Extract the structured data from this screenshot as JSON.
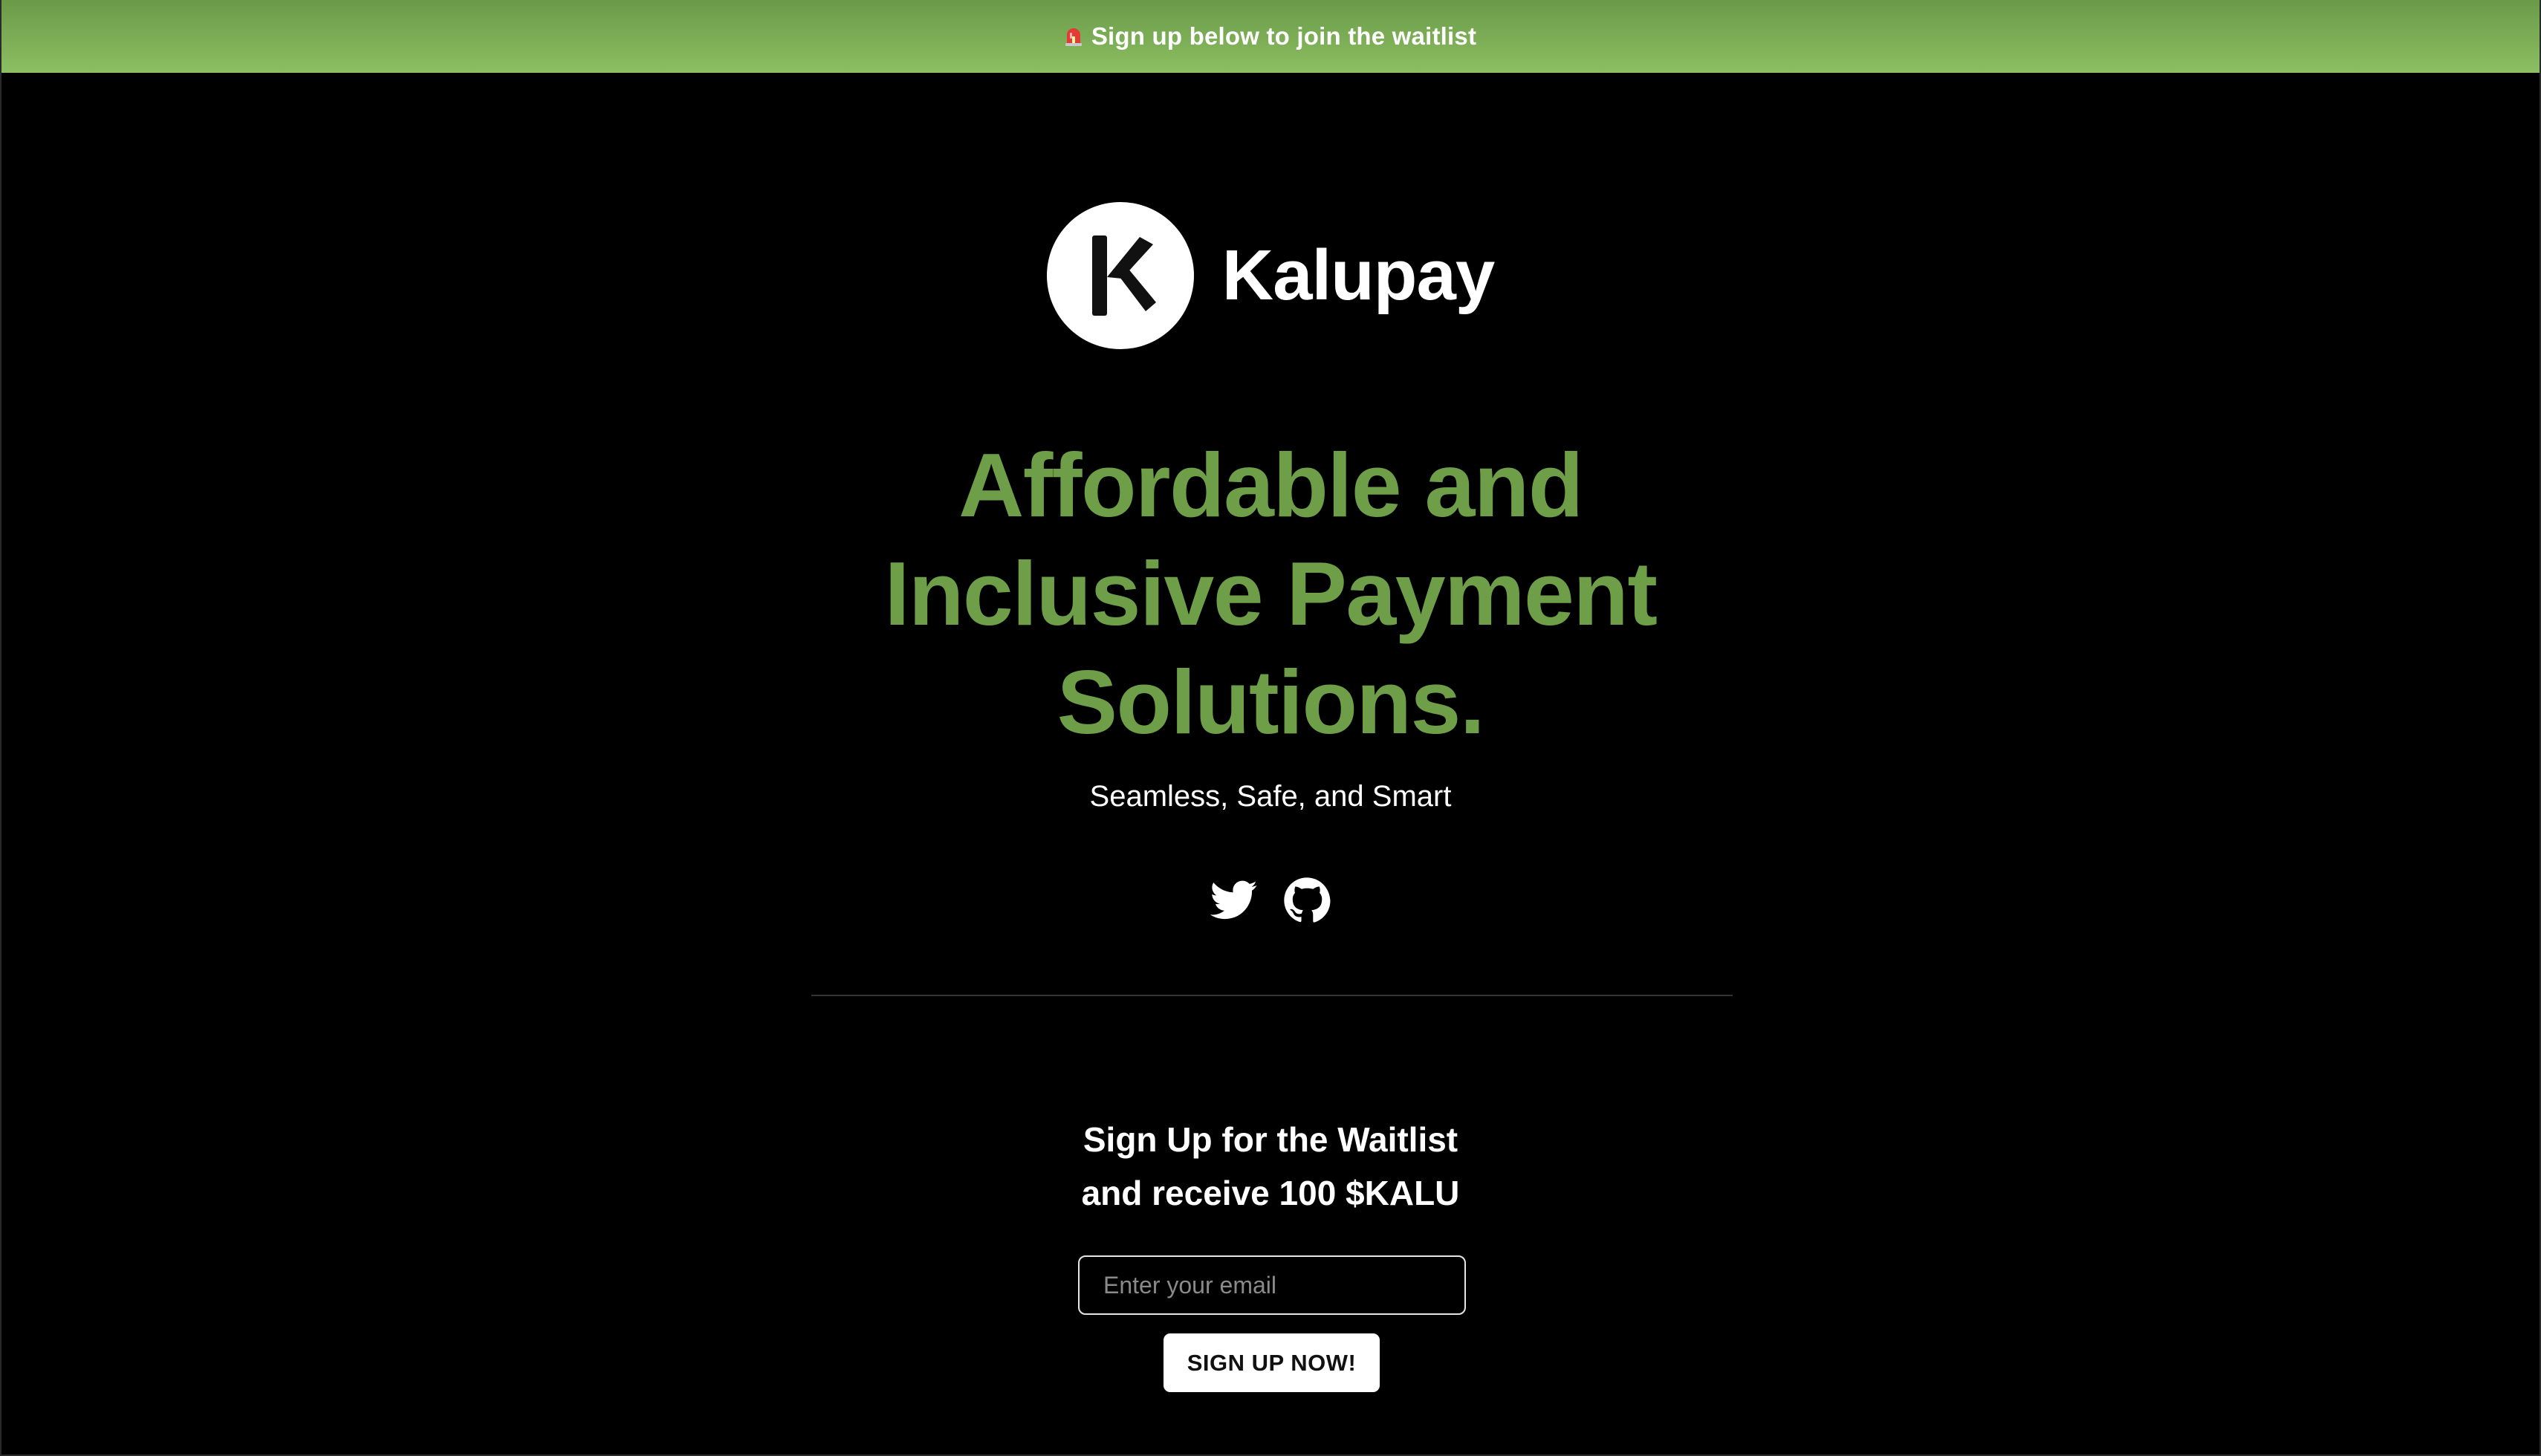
{
  "banner": {
    "icon": "alarm-siren-icon",
    "text": "Sign up below to join the waitlist",
    "colors": {
      "gradient_top": "#6a9a48",
      "gradient_bottom": "#8cbe62"
    }
  },
  "brand": {
    "logo_icon": "kalupay-k-logo-icon",
    "name": "Kalupay"
  },
  "hero": {
    "title_lines": [
      "Affordable and",
      "Inclusive Payment",
      "Solutions."
    ],
    "title_color": "#6f9e48",
    "subtitle": "Seamless, Safe, and Smart"
  },
  "social": [
    {
      "icon": "twitter-icon"
    },
    {
      "icon": "github-icon"
    }
  ],
  "waitlist": {
    "heading_lines": [
      "Sign Up for the Waitlist",
      "and receive 100 $KALU"
    ],
    "email_placeholder": "Enter your email",
    "email_value": "",
    "submit_label": "SIGN UP NOW!"
  }
}
